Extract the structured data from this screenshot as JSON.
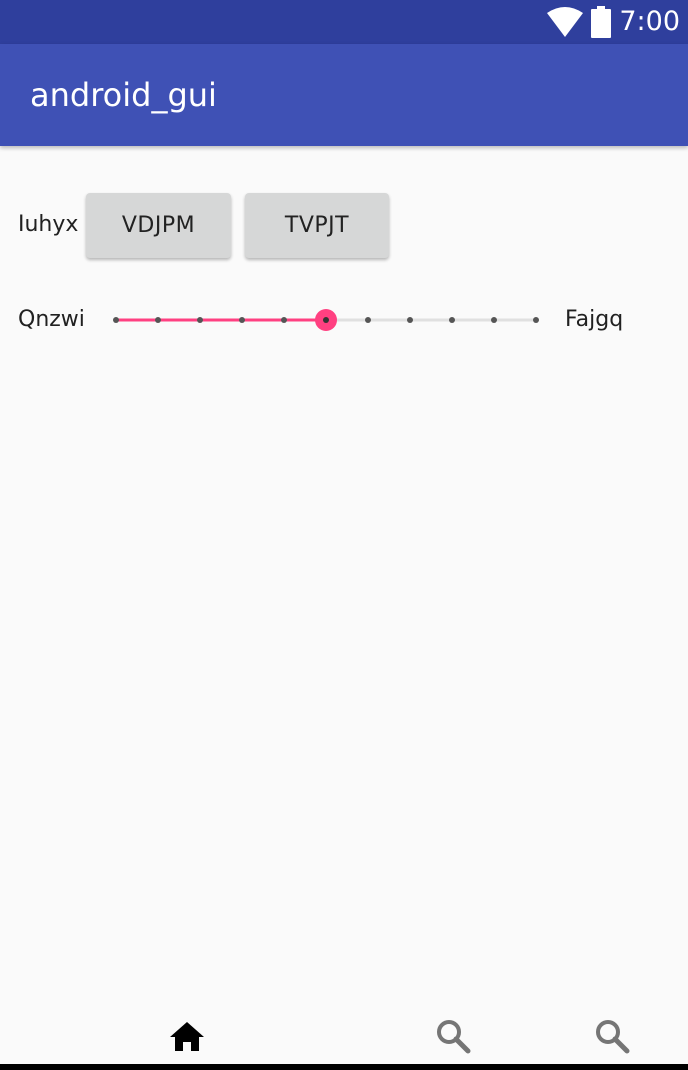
{
  "status_bar": {
    "time": "7:00",
    "icons": [
      "wifi-icon",
      "battery-icon"
    ]
  },
  "app_bar": {
    "title": "android_gui"
  },
  "row1": {
    "label": "Iuhyx",
    "buttons": [
      {
        "label": "VDJPM"
      },
      {
        "label": "TVPJT"
      }
    ]
  },
  "seekbar": {
    "min_label": "Qnzwi",
    "max_label": "Fajgq",
    "value": 5,
    "max": 10,
    "colors": {
      "active": "#ff4081",
      "inactive": "#e0e0e0",
      "tick": "#555555"
    }
  },
  "bottom_nav": {
    "items": [
      {
        "icon": "home-icon"
      },
      {
        "icon": "search-icon"
      },
      {
        "icon": "search-icon"
      }
    ]
  }
}
